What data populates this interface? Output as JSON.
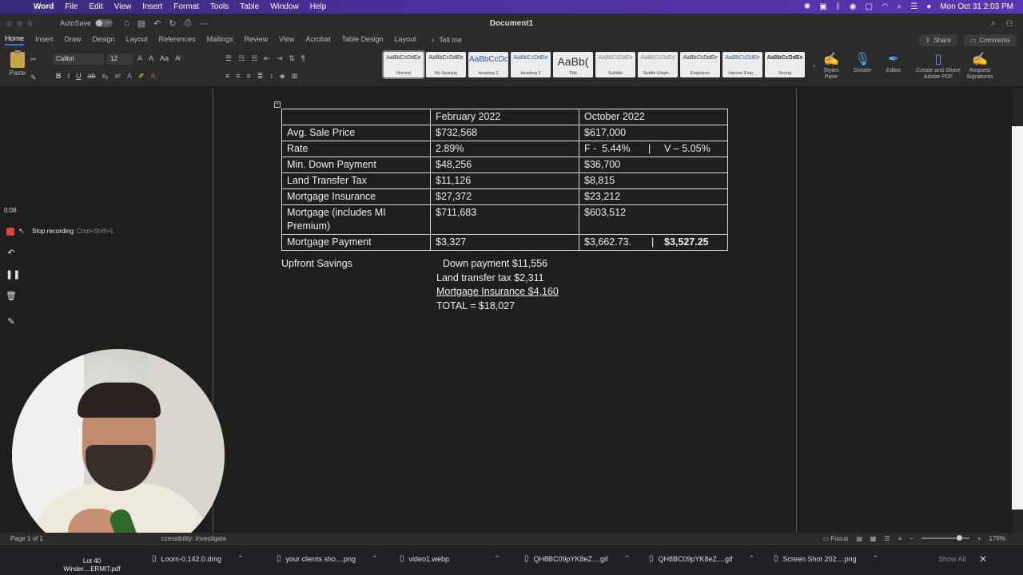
{
  "menubar": {
    "app": "Word",
    "items": [
      "File",
      "Edit",
      "View",
      "Insert",
      "Format",
      "Tools",
      "Table",
      "Window",
      "Help"
    ],
    "datetime": "Mon Oct 31  2:03 PM"
  },
  "titlebar": {
    "autosave_label": "AutoSave",
    "autosave_state": "OFF",
    "document_title": "Document1"
  },
  "ribbon_tabs": {
    "tabs": [
      "Home",
      "Insert",
      "Draw",
      "Design",
      "Layout",
      "References",
      "Mailings",
      "Review",
      "View",
      "Acrobat",
      "Table Design",
      "Layout"
    ],
    "tell_me": "Tell me",
    "share": "Share",
    "comments": "Comments"
  },
  "ribbon": {
    "paste": "Paste",
    "font_name": "Calibri",
    "font_size": "12",
    "styles": [
      {
        "preview": "AaBbCcDdEe",
        "name": "Normal"
      },
      {
        "preview": "AaBbCcDdEe",
        "name": "No Spacing"
      },
      {
        "preview": "AaBbCcDc",
        "name": "Heading 1"
      },
      {
        "preview": "AaBbCcDdEe",
        "name": "Heading 2"
      },
      {
        "preview": "AaBb(",
        "name": "Title"
      },
      {
        "preview": "AaBbCcDdEe",
        "name": "Subtitle"
      },
      {
        "preview": "AaBbCcDdEe",
        "name": "Subtle Emph..."
      },
      {
        "preview": "AaBbCcDdEe",
        "name": "Emphasis"
      },
      {
        "preview": "AaBbCcDdEe",
        "name": "Intense Emp..."
      },
      {
        "preview": "AaBbCcDdEe",
        "name": "Strong"
      }
    ],
    "styles_pane": "Styles Pane",
    "dictate": "Dictate",
    "editor": "Editor",
    "create_share_pdf": "Create and Share Adobe PDF",
    "request_signatures": "Request Signatures"
  },
  "table": {
    "header": [
      "",
      "February 2022",
      "October 2022"
    ],
    "rows": [
      {
        "label": "Avg. Sale Price",
        "feb": "$732,568",
        "oct": "$617,000"
      },
      {
        "label": "Rate",
        "feb": "2.89%",
        "oct_a": "F -  5.44%",
        "oct_sep": "|",
        "oct_b": "V – 5.05%"
      },
      {
        "label": "Min. Down Payment",
        "feb": "$48,256",
        "oct": "$36,700"
      },
      {
        "label": "Land Transfer Tax",
        "feb": "$11,126",
        "oct": "$8,815"
      },
      {
        "label": "Mortgage Insurance",
        "feb": "$27,372",
        "oct": "$23,212"
      },
      {
        "label": "Mortgage (includes MI Premium)",
        "feb": "$711,683",
        "oct": "$603,512"
      },
      {
        "label": "Mortgage Payment",
        "feb": "$3,327",
        "oct_a": "$3,662.73.",
        "oct_sep": "|",
        "oct_b": "$3,527.25"
      }
    ]
  },
  "savings": {
    "label": "Upfront Savings",
    "lines": [
      "Down payment $11,556",
      "Land transfer tax $2,311",
      "Mortgage Insurance $4,160",
      "TOTAL = $18,027"
    ]
  },
  "loom": {
    "timer": "0:08",
    "stop_label": "Stop recording",
    "stop_shortcut": "Cmd+Shift+L"
  },
  "statusbar": {
    "page": "Page 1 of 1",
    "accessibility": "ccessibility: Investigate",
    "focus": "Focus",
    "zoom": "179%"
  },
  "downloads": {
    "first": "Lot 40 Winder....ERMIT.pdf",
    "items": [
      "Loom-0.142.0.dmg",
      "your clients sho....png",
      "video1.webp",
      "QH8BC09pYK8eZ....gif",
      "QH8BC09pYK8eZ....gif",
      "Screen Shot 202....png"
    ],
    "show_all": "Show All"
  },
  "colors": {
    "menubar": "#4b2f9a",
    "accent": "#2f7bd8",
    "stop": "#e0433a"
  }
}
